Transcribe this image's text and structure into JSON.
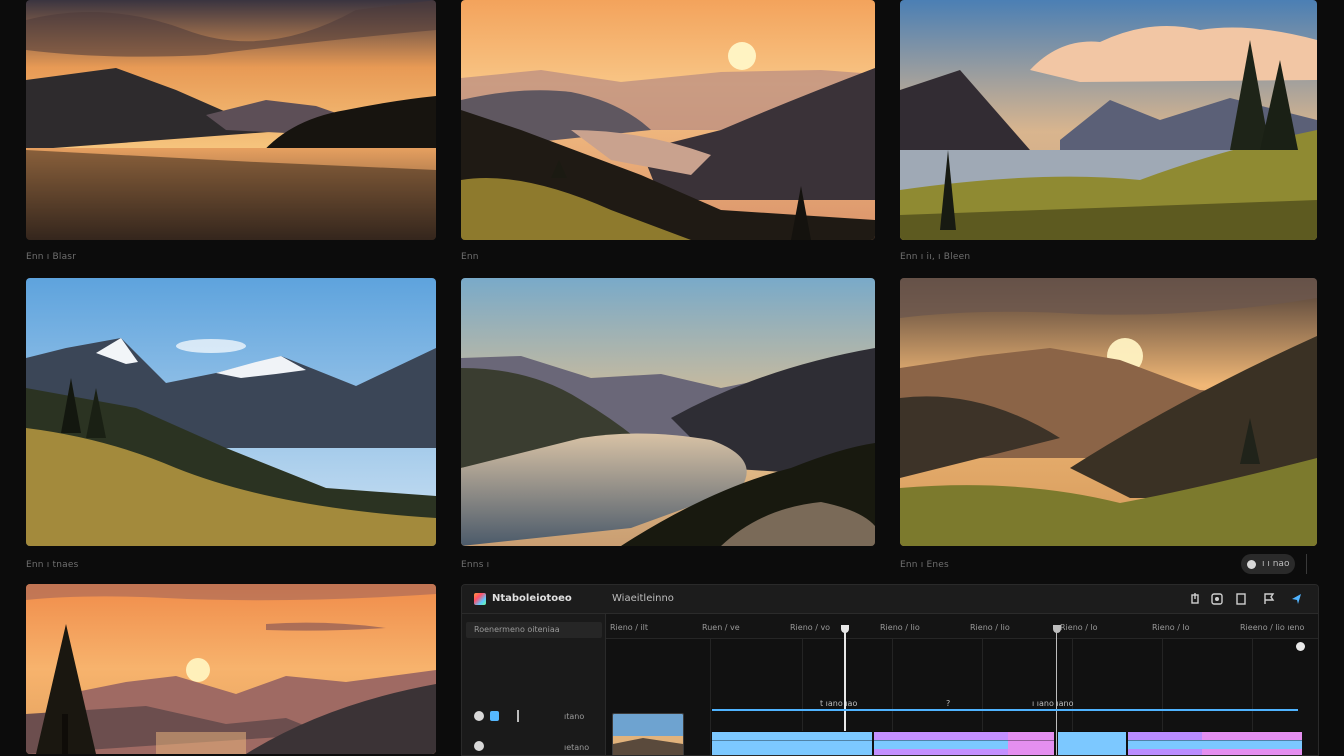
{
  "gallery": {
    "captions": {
      "c1": "Enn ı Blasr",
      "c2": "Enn",
      "c3": "Enn ı iı, ı Bleen",
      "c4": "Enn ı tnaes",
      "c5": "Enns ı",
      "c6": "Enn ı Enes"
    },
    "pill_label": "ı ı nao"
  },
  "editor": {
    "app_name": "Ntaboleiotoeo",
    "file_name": "Wiaeitleinno",
    "layer_label": "Roenermeno oiteniaa",
    "ruler_ticks": [
      "Rieno / ilt",
      "Ruen / ve",
      "Rieno / vo",
      "Rieno / lio",
      "Rieno / lio",
      "Rieno / lo",
      "Rieno / lo",
      "Rieeno / lio ıeno"
    ],
    "marker_labels": [
      "t ıano ıao",
      "?",
      "ı ıano ıano"
    ],
    "layer_rows": [
      {
        "value": "ıtano"
      },
      {
        "value": "ıetano"
      }
    ],
    "colors": {
      "accent": "#4fb3ff",
      "clip_blue": "#7cc8ff",
      "clip_violet": "#b98cff",
      "clip_pink": "#e48ff0"
    }
  }
}
